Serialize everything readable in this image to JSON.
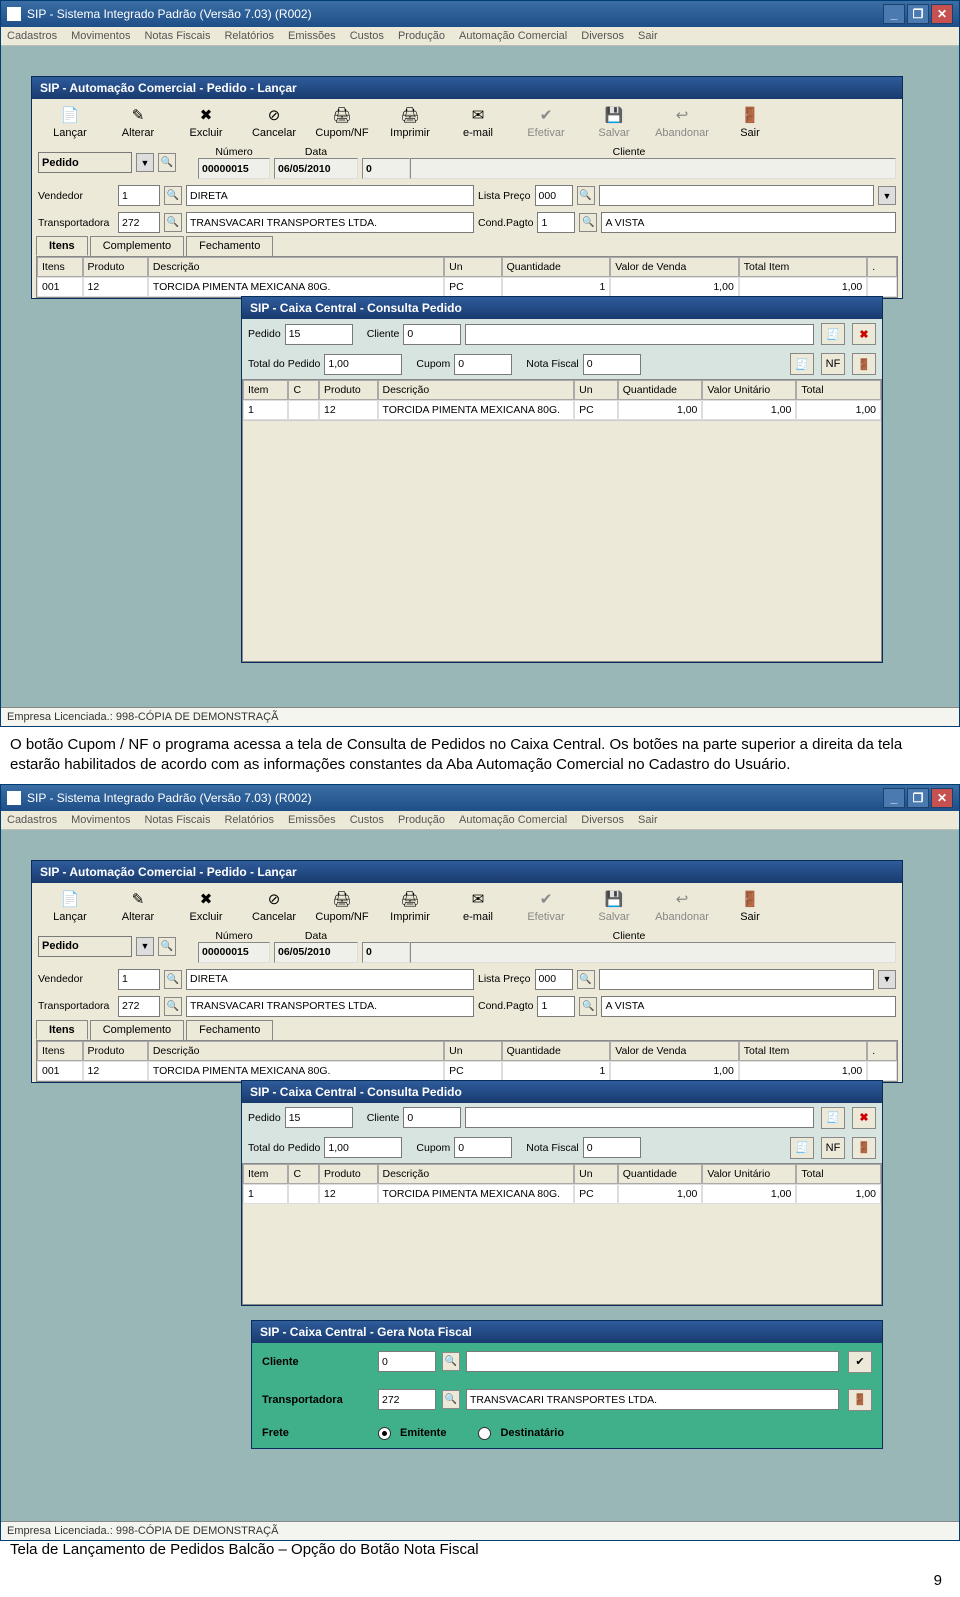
{
  "app": {
    "title": "SIP - Sistema Integrado Padrão  (Versão  7.03)  (R002)",
    "menu": [
      "Cadastros",
      "Movimentos",
      "Notas Fiscais",
      "Relatórios",
      "Emissões",
      "Custos",
      "Produção",
      "Automação Comercial",
      "Diversos",
      "Sair"
    ],
    "license": "Empresa Licenciada.: 998-CÓPIA DE DEMONSTRAÇÃ"
  },
  "sub": {
    "title": "SIP  - Automação Comercial - Pedido - Lançar",
    "toolbar": [
      {
        "label": "Lançar",
        "icon": "📄"
      },
      {
        "label": "Alterar",
        "icon": "✎"
      },
      {
        "label": "Excluir",
        "icon": "✖"
      },
      {
        "label": "Cancelar",
        "icon": "⊘"
      },
      {
        "label": "Cupom/NF",
        "icon": "🖨"
      },
      {
        "label": "Imprimir",
        "icon": "🖨"
      },
      {
        "label": "e-mail",
        "icon": "✉"
      },
      {
        "label": "Efetivar",
        "icon": "✔",
        "disabled": true
      },
      {
        "label": "Salvar",
        "icon": "💾",
        "disabled": true
      },
      {
        "label": "Abandonar",
        "icon": "↩",
        "disabled": true
      },
      {
        "label": "Sair",
        "icon": "🚪"
      }
    ],
    "pedido_label": "Pedido",
    "numero_lbl": "Número",
    "numero": "00000015",
    "data_lbl": "Data",
    "data": "06/05/2010",
    "cliente_lbl": "Cliente",
    "cliente_cod": "0",
    "vendedor_lbl": "Vendedor",
    "vendedor_cod": "1",
    "vendedor": "DIRETA",
    "lista_lbl": "Lista Preço",
    "lista": "000",
    "transp_lbl": "Transportadora",
    "transp_cod": "272",
    "transp": "TRANSVACARI TRANSPORTES LTDA.",
    "cond_lbl": "Cond.Pagto",
    "cond_cod": "1",
    "cond": "A VISTA",
    "tabs": [
      "Itens",
      "Complemento",
      "Fechamento"
    ],
    "grid_headers": [
      "Itens",
      "Produto",
      "Descrição",
      "Un",
      "Quantidade",
      "Valor de Venda",
      "Total Item",
      "."
    ],
    "grid_row": [
      "001",
      "12",
      "TORCIDA PIMENTA MEXICANA 80G.",
      "PC",
      "1",
      "1,00",
      "1,00",
      ""
    ]
  },
  "modal": {
    "title": "SIP  - Caixa Central - Consulta Pedido",
    "pedido_lbl": "Pedido",
    "pedido": "15",
    "cliente_lbl": "Cliente",
    "cliente": "0",
    "total_lbl": "Total do Pedido",
    "total": "1,00",
    "cupom_lbl": "Cupom",
    "cupom": "0",
    "nf_lbl": "Nota Fiscal",
    "nf": "0",
    "nf_btn": "NF",
    "grid_headers": [
      "Item",
      "C",
      "Produto",
      "Descrição",
      "Un",
      "Quantidade",
      "Valor Unitário",
      "Total"
    ],
    "grid_row": [
      "1",
      "",
      "12",
      "TORCIDA PIMENTA MEXICANA 80G.",
      "PC",
      "1,00",
      "1,00",
      "1,00"
    ]
  },
  "modal2": {
    "title": "SIP  - Caixa Central - Gera Nota Fiscal",
    "cliente_lbl": "Cliente",
    "cliente": "0",
    "transp_lbl": "Transportadora",
    "transp_cod": "272",
    "transp": "TRANSVACARI TRANSPORTES LTDA.",
    "frete_lbl": "Frete",
    "opt1": "Emitente",
    "opt2": "Destinatário"
  },
  "text": {
    "para": "O botão Cupom / NF o programa acessa a tela de Consulta de Pedidos no Caixa Central. Os botões na parte superior a direita da tela estarão habilitados de acordo com as informações constantes da Aba Automação Comercial no Cadastro do Usuário.",
    "caption": "Tela de Lançamento de Pedidos Balcão – Opção do Botão Nota Fiscal",
    "pagenum": "9"
  }
}
